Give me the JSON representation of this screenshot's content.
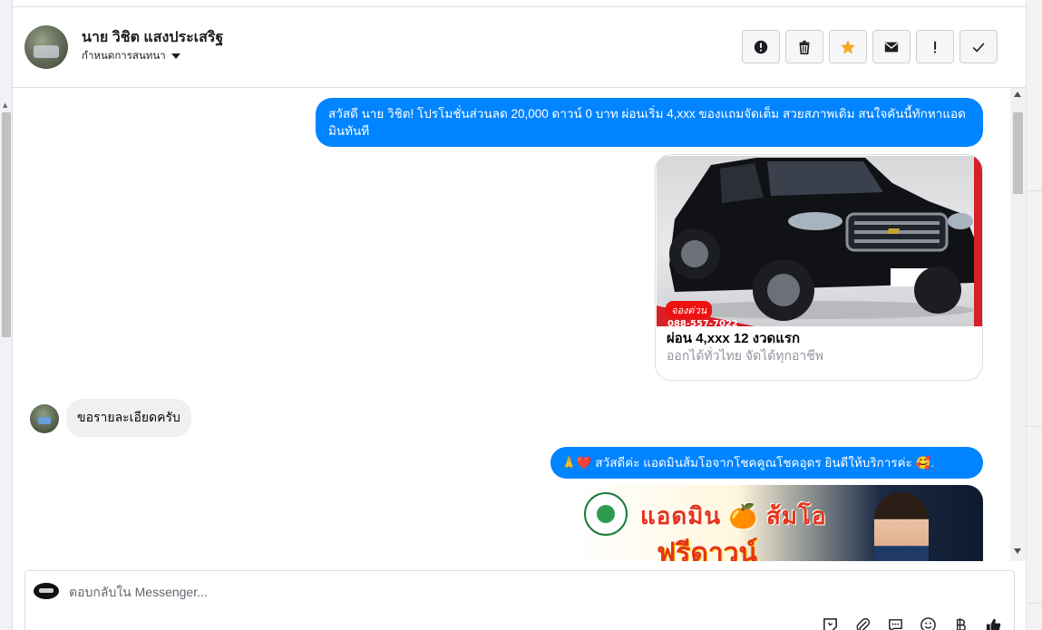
{
  "header": {
    "contact_name": "นาย วิชิต แสงประเสริฐ",
    "subtitle": "กำหนดการสนทนา",
    "actions": [
      {
        "name": "report-spam-button",
        "icon": "alert-circle-icon"
      },
      {
        "name": "delete-button",
        "icon": "trash-icon"
      },
      {
        "name": "star-button",
        "icon": "star-icon"
      },
      {
        "name": "mark-unread-button",
        "icon": "envelope-icon"
      },
      {
        "name": "follow-up-button",
        "icon": "exclamation-icon"
      },
      {
        "name": "mark-done-button",
        "icon": "check-icon"
      }
    ]
  },
  "messages": {
    "m1": {
      "text": "สวัสดี นาย วิชิต! โปรโมชั่นส่วนลด 20,000 ดาวน์ 0 บาท ผ่อนเริ่ม 4,xxx  ของแถมจัดเต็ม สวยสภาพเดิม สนใจคันนี้ทักหาแอดมินทันที"
    },
    "card": {
      "tag": "จองด่วน",
      "phone": "088-557-7022",
      "title": "ผ่อน 4,xxx 12 งวดแรก",
      "subtitle": "ออกได้ทั่วไทย จัดได้ทุกอาชีพ"
    },
    "m2": {
      "text": "ขอรายละเอียดครับ"
    },
    "m3": {
      "text": "🙏❤️ สวัสดีค่ะ แอดมินส้มโอจากโชคคูณโชคอุดร ยินดีให้บริการค่ะ 🥰."
    },
    "promo": {
      "line1": "แอดมิน 🍊 ส้มโอ",
      "line2": "ฟรีดาวน์"
    }
  },
  "composer": {
    "placeholder": "ตอบกลับใน Messenger...",
    "tools": [
      "sticker-icon",
      "paperclip-icon",
      "saved-reply-icon",
      "emoji-icon",
      "baht-icon",
      "thumbs-up-icon"
    ]
  },
  "colors": {
    "outgoing_bubble": "#0084ff",
    "incoming_bubble": "#f0f0f0",
    "star": "#f5a623"
  }
}
